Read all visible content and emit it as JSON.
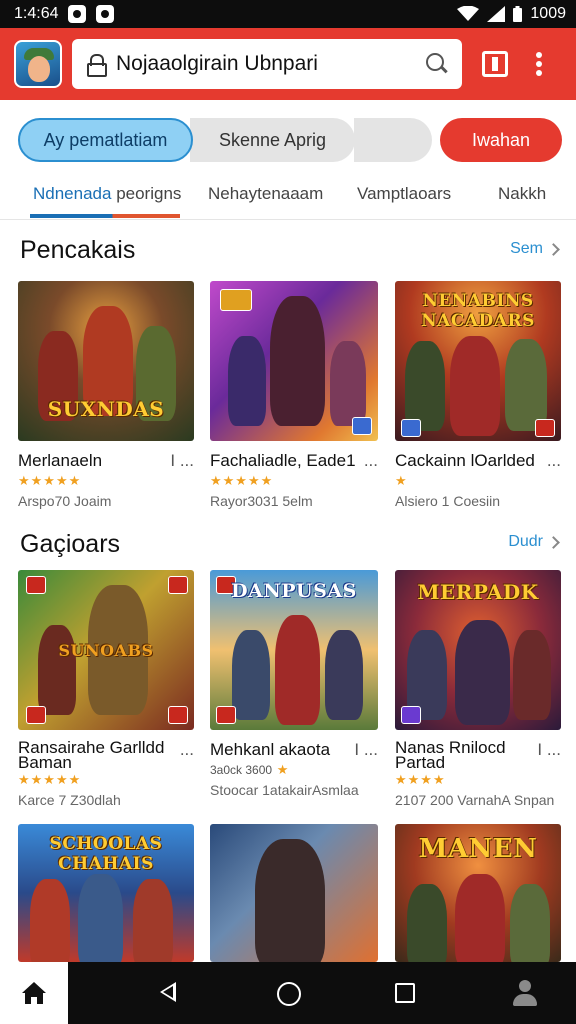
{
  "status_bar": {
    "time": "1:4:64",
    "battery": "1009"
  },
  "app_bar": {
    "search_text": "Nojaaolgirain Ubnpari"
  },
  "chips": [
    "Ay pematlatiam",
    "Skenne Aprig",
    "",
    "Iwahan"
  ],
  "tabs": [
    {
      "part1": "Ndnenada",
      "part2": " peorigns"
    },
    {
      "part1": "Nehaytenaaam",
      "part2": ""
    },
    {
      "part1": "Vamptlaoars",
      "part2": ""
    },
    {
      "part1": "Nakkh",
      "part2": ""
    }
  ],
  "sections": [
    {
      "title": "Pencakais",
      "see_all": "Sem",
      "cards": [
        {
          "banner": "SUXNDAS",
          "title": "Merlanaeln",
          "dots": "I ...",
          "stars": "★★★★★",
          "rating": "",
          "meta": "Arspo70 Joaim"
        },
        {
          "banner": "",
          "title": "Fachaliadle, Eade1",
          "dots": "...",
          "stars": "★★★★★",
          "rating": "",
          "meta": "Rayor3031 5elm"
        },
        {
          "banner": "NENABINS NACADARS",
          "title": "Cackainn lOarlded",
          "dots": "...",
          "stars": "★",
          "rating": "",
          "meta": "Alsiero 1 Coesiin"
        }
      ]
    },
    {
      "title": "Gaçioars",
      "see_all": "Dudr",
      "cards": [
        {
          "banner": "SUNOABS",
          "title": "Ransairahe Garlldd Baman",
          "dots": "...",
          "stars": "★★★★★",
          "rating": "",
          "meta": "Karce 7 Z30dlah"
        },
        {
          "banner": "DANPUSAS",
          "title": "Mehkanl akaota",
          "dots": "I ...",
          "stars": "★",
          "rating": "3a0ck 3600",
          "meta": "Stoocar 1atakairAsmlaa"
        },
        {
          "banner": "MERPADK",
          "title": "Nanas Rnilocd Partad",
          "dots": "I ...",
          "stars": "★★★★",
          "rating": "",
          "meta": "2107 200 VarnahA Snpan"
        }
      ]
    },
    {
      "title": "",
      "see_all": "",
      "cards": [
        {
          "banner": "SCHOOLAS CHAHAIS",
          "title": "",
          "dots": "",
          "stars": "",
          "rating": "",
          "meta": ""
        },
        {
          "banner": "",
          "title": "",
          "dots": "",
          "stars": "",
          "rating": "",
          "meta": ""
        },
        {
          "banner": "MANEN",
          "title": "",
          "dots": "",
          "stars": "",
          "rating": "",
          "meta": ""
        }
      ]
    }
  ],
  "colors": {
    "brand_red": "#e53a2f",
    "accent_blue": "#2b8fd0",
    "star": "#f0a020"
  },
  "icons": [
    "lock-icon",
    "search-icon",
    "tabs-icon",
    "more-vert-icon",
    "chevron-right-icon",
    "home-icon",
    "back-icon",
    "home-circle-icon",
    "recents-icon",
    "profile-icon"
  ]
}
